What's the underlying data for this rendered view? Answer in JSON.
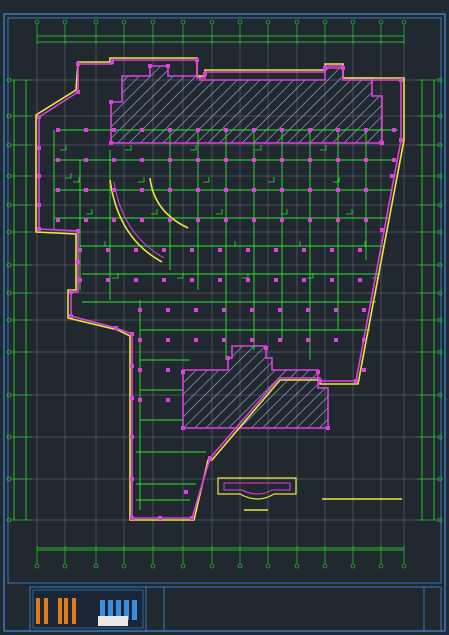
{
  "canvas": {
    "background": "#212830",
    "frame_color": "#3b8fe0",
    "grid_color": "#6e747a",
    "dimension_color": "#27e827",
    "wall_color": "#e8e83a",
    "column_color": "#e040e0",
    "hatch_color": "#9ab8dc",
    "title_block_accent": "#e07a1a"
  },
  "drawing": {
    "type": "structural floor plan (CAD)",
    "grid_axes_top_count": 15,
    "grid_axes_side_count": 17,
    "hatched_zones": 2,
    "visible_text": []
  },
  "title_block": {
    "cells": 6
  }
}
